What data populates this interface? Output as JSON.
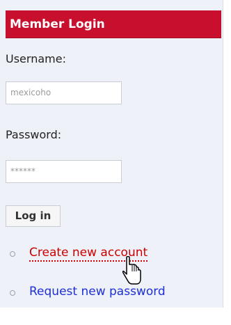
{
  "login_block": {
    "title": "Member Login",
    "username_label": "Username:",
    "username_value": "mexicoho",
    "password_label": "Password:",
    "password_mask": "******",
    "login_button": "Log in",
    "links": [
      {
        "label": "Create new account"
      },
      {
        "label": "Request new password"
      }
    ]
  },
  "colors": {
    "header_bg": "#c8102e",
    "panel_bg": "#eef1f8",
    "link_create": "#cc0000",
    "link_request": "#1d2fd6"
  },
  "icons": {
    "cursor": "pointer-cursor-icon",
    "bullet": "circle-bullet-icon"
  }
}
